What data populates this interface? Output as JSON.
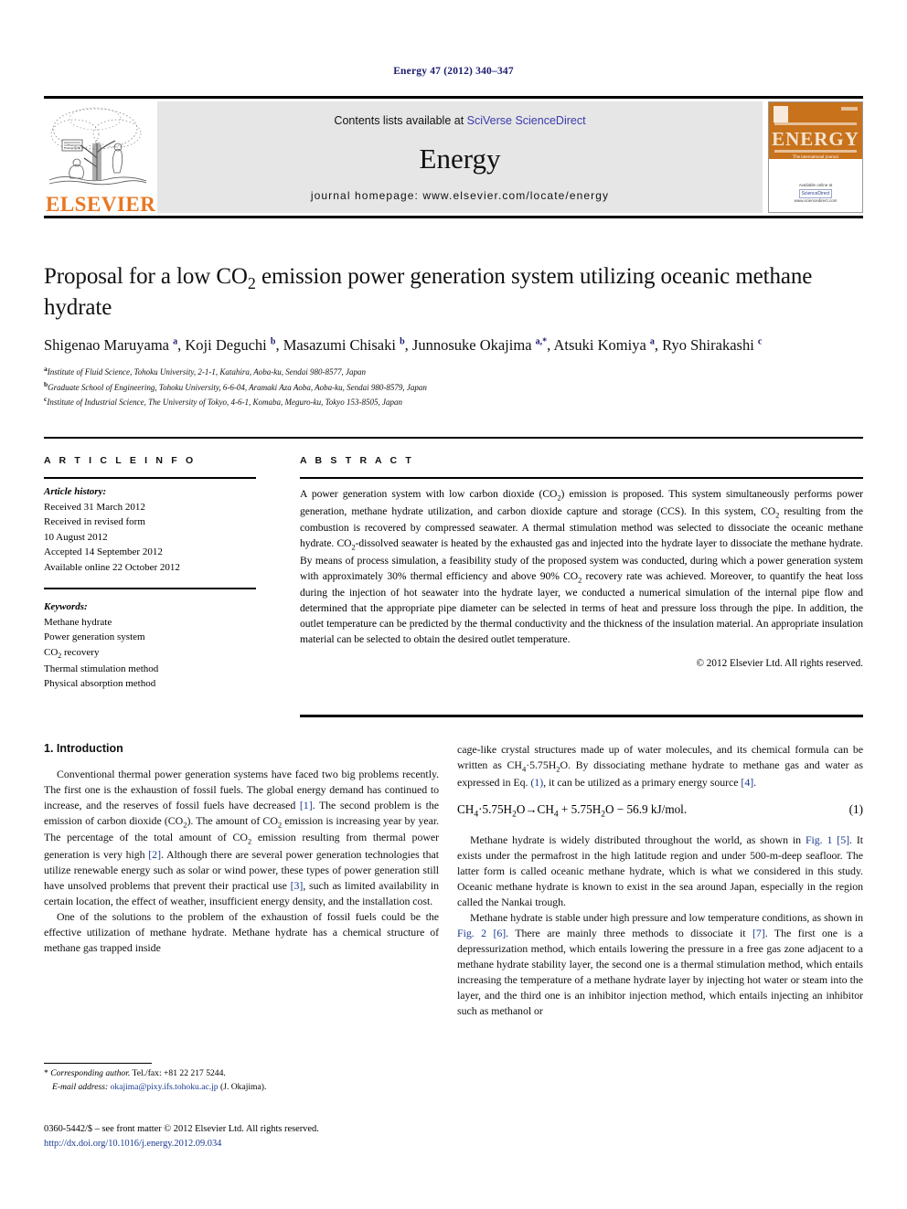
{
  "running_head": "Energy 47 (2012) 340–347",
  "masthead": {
    "publisher_logo_text": "ELSEVIER",
    "contents_prefix": "Contents lists available at ",
    "contents_link": "SciVerse ScienceDirect",
    "journal_name": "Energy",
    "homepage": "journal homepage: www.elsevier.com/locate/energy",
    "cover": {
      "title": "ENERGY",
      "subtitle": "The international journal",
      "footer_line1": "Available online at",
      "sciencedirect_mark": "ScienceDirect",
      "footer_line2": "www.sciencedirect.com"
    },
    "accent_orange": "#E87722",
    "link_blue": "#3b3bb0",
    "panel_gray": "#e6e6e6"
  },
  "article": {
    "title": "Proposal for a low CO2 emission power generation system utilizing oceanic methane hydrate",
    "authors_html": "Shigenao Maruyama <sup>a</sup>, Koji Deguchi <sup>b</sup>, Masazumi Chisaki <sup>b</sup>, Junnosuke Okajima <sup>a,*</sup>, Atsuki Komiya <sup>a</sup>, Ryo Shirakashi <sup>c</sup>",
    "affiliations": [
      {
        "mark": "a",
        "text": "Institute of Fluid Science, Tohoku University, 2-1-1, Katahira, Aoba-ku, Sendai 980-8577, Japan"
      },
      {
        "mark": "b",
        "text": "Graduate School of Engineering, Tohoku University, 6-6-04, Aramaki Aza Aoba, Aoba-ku, Sendai 980-8579, Japan"
      },
      {
        "mark": "c",
        "text": "Institute of Industrial Science, The University of Tokyo, 4-6-1, Komaba, Meguro-ku, Tokyo 153-8505, Japan"
      }
    ]
  },
  "article_info": {
    "heading": "A R T I C L E   I N F O",
    "history_label": "Article history:",
    "history": [
      "Received 31 March 2012",
      "Received in revised form",
      "10 August 2012",
      "Accepted 14 September 2012",
      "Available online 22 October 2012"
    ],
    "keywords_label": "Keywords:",
    "keywords": [
      "Methane hydrate",
      "Power generation system",
      "CO2 recovery",
      "Thermal stimulation method",
      "Physical absorption method"
    ]
  },
  "abstract": {
    "heading": "A B S T R A C T",
    "text": "A power generation system with low carbon dioxide (CO2) emission is proposed. This system simultaneously performs power generation, methane hydrate utilization, and carbon dioxide capture and storage (CCS). In this system, CO2 resulting from the combustion is recovered by compressed seawater. A thermal stimulation method was selected to dissociate the oceanic methane hydrate. CO2-dissolved seawater is heated by the exhausted gas and injected into the hydrate layer to dissociate the methane hydrate. By means of process simulation, a feasibility study of the proposed system was conducted, during which a power generation system with approximately 30% thermal efficiency and above 90% CO2 recovery rate was achieved. Moreover, to quantify the heat loss during the injection of hot seawater into the hydrate layer, we conducted a numerical simulation of the internal pipe flow and determined that the appropriate pipe diameter can be selected in terms of heat and pressure loss through the pipe. In addition, the outlet temperature can be predicted by the thermal conductivity and the thickness of the insulation material. An appropriate insulation material can be selected to obtain the desired outlet temperature.",
    "copyright": "© 2012 Elsevier Ltd. All rights reserved."
  },
  "body": {
    "section_heading": "1. Introduction",
    "left_paragraphs": [
      "Conventional thermal power generation systems have faced two big problems recently. The first one is the exhaustion of fossil fuels. The global energy demand has continued to increase, and the reserves of fossil fuels have decreased [1]. The second problem is the emission of carbon dioxide (CO2). The amount of CO2 emission is increasing year by year. The percentage of the total amount of CO2 emission resulting from thermal power generation is very high [2]. Although there are several power generation technologies that utilize renewable energy such as solar or wind power, these types of power generation still have unsolved problems that prevent their practical use [3], such as limited availability in certain location, the effect of weather, insufficient energy density, and the installation cost.",
      "One of the solutions to the problem of the exhaustion of fossil fuels could be the effective utilization of methane hydrate. Methane hydrate has a chemical structure of methane gas trapped inside"
    ],
    "right_paragraphs": [
      "cage-like crystal structures made up of water molecules, and its chemical formula can be written as CH4·5.75H2O. By dissociating methane hydrate to methane gas and water as expressed in Eq. (1), it can be utilized as a primary energy source [4].",
      "Methane hydrate is widely distributed throughout the world, as shown in Fig. 1 [5]. It exists under the permafrost in the high latitude region and under 500-m-deep seafloor. The latter form is called oceanic methane hydrate, which is what we considered in this study. Oceanic methane hydrate is known to exist in the sea around Japan, especially in the region called the Nankai trough.",
      "Methane hydrate is stable under high pressure and low temperature conditions, as shown in Fig. 2 [6]. There are mainly three methods to dissociate it [7]. The first one is a depressurization method, which entails lowering the pressure in a free gas zone adjacent to a methane hydrate stability layer, the second one is a thermal stimulation method, which entails increasing the temperature of a methane hydrate layer by injecting hot water or steam into the layer, and the third one is an inhibitor injection method, which entails injecting an inhibitor such as methanol or"
    ],
    "equation": "CH4·5.75H2O→CH4 + 5.75H2O − 56.9 kJ/mol.",
    "equation_number": "(1)"
  },
  "footnotes": {
    "corresponding_marker": "*",
    "corresponding_label": "Corresponding author.",
    "corresponding_tel": "Tel./fax: +81 22 217 5244.",
    "email_label": "E-mail address:",
    "email": "okajima@pixy.ifs.tohoku.ac.jp",
    "email_person": "(J. Okajima).",
    "imprint": "0360-5442/$ – see front matter © 2012 Elsevier Ltd. All rights reserved.",
    "doi": "http://dx.doi.org/10.1016/j.energy.2012.09.034"
  }
}
